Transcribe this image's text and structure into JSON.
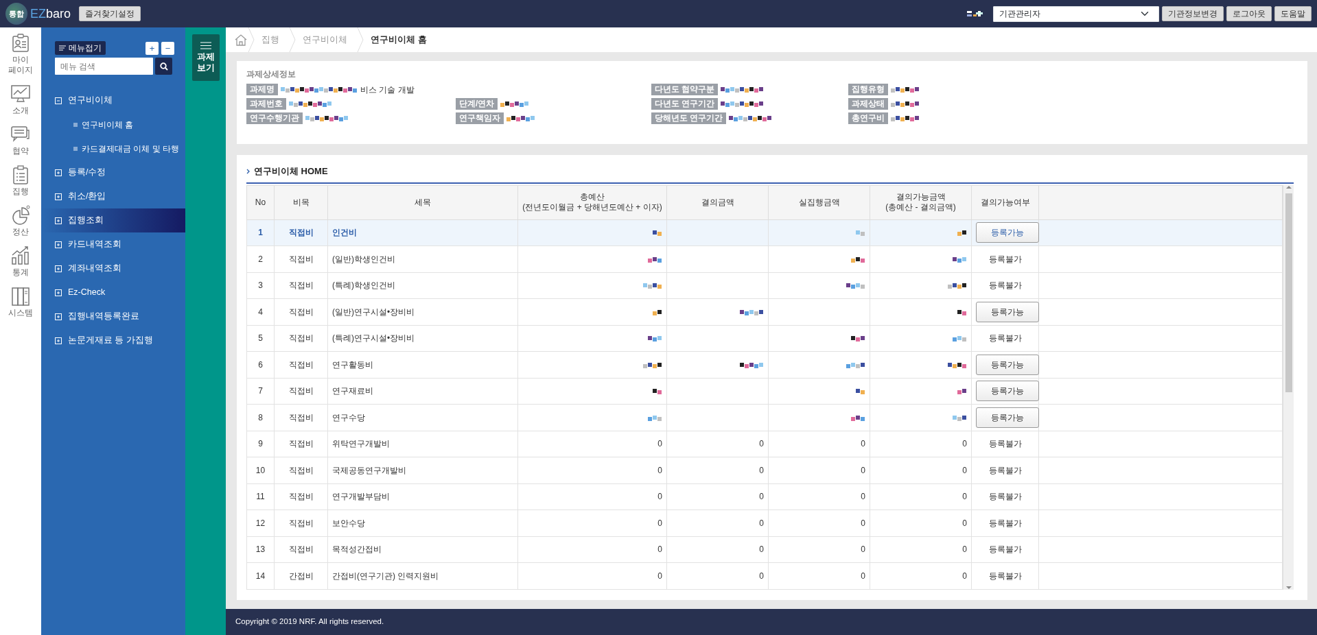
{
  "topbar": {
    "logo_badge": "통합",
    "brand_first": "EZ",
    "brand_rest": "baro",
    "favorites_button": "즐겨찾기설정",
    "role_select": "기관관리자",
    "buttons": [
      "기관정보변경",
      "로그아웃",
      "도움말"
    ]
  },
  "rail": [
    {
      "label": "마이 페이지",
      "kind": "profile"
    },
    {
      "label": "소개",
      "kind": "monitor"
    },
    {
      "label": "협약",
      "kind": "chat"
    },
    {
      "label": "집행",
      "kind": "clipboard"
    },
    {
      "label": "정산",
      "kind": "pie"
    },
    {
      "label": "통계",
      "kind": "bars"
    },
    {
      "label": "시스템",
      "kind": "binder"
    }
  ],
  "menu": {
    "collapse_button": "메뉴접기",
    "expand_all": "+",
    "collapse_all": "−",
    "search_placeholder": "메뉴 검색",
    "items": [
      {
        "label": "연구비이체",
        "expanded": true,
        "selected": false,
        "children": [
          {
            "label": "연구비이체 홈"
          },
          {
            "label": "카드결제대금 이체 및 타행"
          }
        ]
      },
      {
        "label": "등록/수정",
        "expanded": false,
        "selected": false
      },
      {
        "label": "취소/환입",
        "expanded": false,
        "selected": false
      },
      {
        "label": "집행조회",
        "expanded": false,
        "selected": true
      },
      {
        "label": "카드내역조회",
        "expanded": false,
        "selected": false
      },
      {
        "label": "계좌내역조회",
        "expanded": false,
        "selected": false
      },
      {
        "label": "Ez-Check",
        "expanded": false,
        "selected": false
      },
      {
        "label": "집행내역등록완료",
        "expanded": false,
        "selected": false
      },
      {
        "label": "논문게재료 등 가집행",
        "expanded": false,
        "selected": false
      }
    ]
  },
  "task_view_button": "과제 보기",
  "breadcrumb": [
    "집행",
    "연구비이체",
    "연구비이체 홈"
  ],
  "project_info": {
    "title": "과제상세정보",
    "rows": [
      [
        {
          "label": "과제명",
          "value": "비스 기술 개발",
          "masked": true
        },
        "",
        {
          "label": "다년도 협약구분",
          "masked": true
        },
        {
          "label": "집행유형",
          "masked": true
        }
      ],
      [
        {
          "label": "과제번호",
          "masked": true
        },
        {
          "label": "단계/연차",
          "masked": true
        },
        {
          "label": "다년도 연구기간",
          "masked": true
        },
        {
          "label": "과제상태",
          "masked": true
        }
      ],
      [
        {
          "label": "연구수행기관",
          "masked": true
        },
        {
          "label": "연구책임자",
          "masked": true
        },
        {
          "label": "당해년도 연구기간",
          "masked": true
        },
        {
          "label": "총연구비",
          "masked": true
        }
      ]
    ]
  },
  "table_section": {
    "title": "연구비이체 HOME",
    "columns": [
      {
        "label": "No"
      },
      {
        "label": "비목"
      },
      {
        "label": "세목"
      },
      {
        "label": "총예산",
        "sub": "(전년도이월금 + 당해년도예산 + 이자)"
      },
      {
        "label": "결의금액"
      },
      {
        "label": "실집행금액"
      },
      {
        "label": "결의가능금액",
        "sub": "(총예산 - 결의금액)"
      },
      {
        "label": "결의가능여부"
      }
    ],
    "rows": [
      {
        "no": "1",
        "category": "직접비",
        "item": "인건비",
        "selected": true,
        "masked": [
          true,
          false,
          true,
          true
        ],
        "action": {
          "kind": "button",
          "label": "등록가능"
        }
      },
      {
        "no": "2",
        "category": "직접비",
        "item": "(일반)학생인건비",
        "selected": false,
        "masked": [
          true,
          false,
          true,
          true
        ],
        "action": {
          "kind": "text",
          "label": "등록불가"
        }
      },
      {
        "no": "3",
        "category": "직접비",
        "item": "(특례)학생인건비",
        "selected": false,
        "masked": [
          true,
          false,
          true,
          true
        ],
        "action": {
          "kind": "text",
          "label": "등록불가"
        }
      },
      {
        "no": "4",
        "category": "직접비",
        "item": "(일반)연구시설•장비비",
        "selected": false,
        "masked": [
          true,
          true,
          false,
          true
        ],
        "action": {
          "kind": "button",
          "label": "등록가능"
        }
      },
      {
        "no": "5",
        "category": "직접비",
        "item": "(특례)연구시설•장비비",
        "selected": false,
        "masked": [
          true,
          false,
          true,
          true
        ],
        "action": {
          "kind": "text",
          "label": "등록불가"
        }
      },
      {
        "no": "6",
        "category": "직접비",
        "item": "연구활동비",
        "selected": false,
        "masked": [
          true,
          true,
          true,
          true
        ],
        "action": {
          "kind": "button",
          "label": "등록가능"
        }
      },
      {
        "no": "7",
        "category": "직접비",
        "item": "연구재료비",
        "selected": false,
        "masked": [
          true,
          false,
          true,
          true
        ],
        "action": {
          "kind": "button",
          "label": "등록가능"
        }
      },
      {
        "no": "8",
        "category": "직접비",
        "item": "연구수당",
        "selected": false,
        "masked": [
          true,
          false,
          true,
          true
        ],
        "action": {
          "kind": "button",
          "label": "등록가능"
        }
      },
      {
        "no": "9",
        "category": "직접비",
        "item": "위탁연구개발비",
        "selected": false,
        "amounts": [
          "0",
          "0",
          "0",
          "0"
        ],
        "action": {
          "kind": "text",
          "label": "등록불가"
        }
      },
      {
        "no": "10",
        "category": "직접비",
        "item": "국제공동연구개발비",
        "selected": false,
        "amounts": [
          "0",
          "0",
          "0",
          "0"
        ],
        "action": {
          "kind": "text",
          "label": "등록불가"
        }
      },
      {
        "no": "11",
        "category": "직접비",
        "item": "연구개발부담비",
        "selected": false,
        "amounts": [
          "0",
          "0",
          "0",
          "0"
        ],
        "action": {
          "kind": "text",
          "label": "등록불가"
        }
      },
      {
        "no": "12",
        "category": "직접비",
        "item": "보안수당",
        "selected": false,
        "amounts": [
          "0",
          "0",
          "0",
          "0"
        ],
        "action": {
          "kind": "text",
          "label": "등록불가"
        }
      },
      {
        "no": "13",
        "category": "직접비",
        "item": "목적성간접비",
        "selected": false,
        "amounts": [
          "0",
          "0",
          "0",
          "0"
        ],
        "action": {
          "kind": "text",
          "label": "등록불가"
        }
      },
      {
        "no": "14",
        "category": "간접비",
        "item": "간접비(연구기관) 인력지원비",
        "selected": false,
        "amounts": [
          "0",
          "0",
          "0",
          "0"
        ],
        "action": {
          "kind": "text",
          "label": "등록불가"
        }
      }
    ]
  },
  "footer": "Copyright © 2019 NRF. All rights reserved."
}
